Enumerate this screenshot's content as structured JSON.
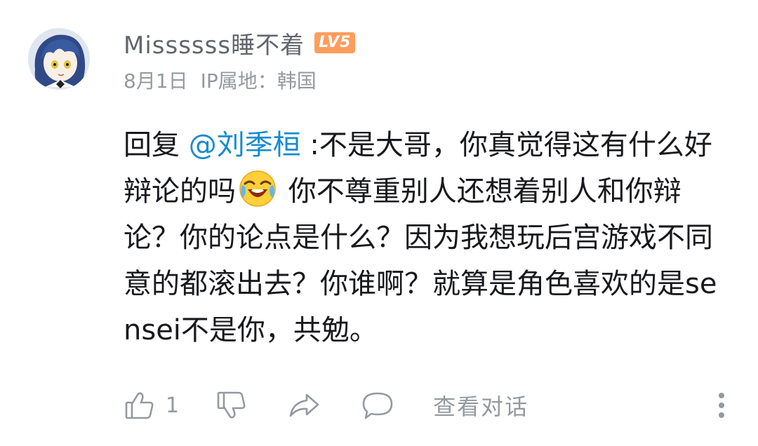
{
  "comment": {
    "username": "Missssss睡不着",
    "level": "LV5",
    "date": "8月1日",
    "ip_location": "IP属地：韩国",
    "content": {
      "reply_prefix": "回复 ",
      "mention": "@刘季桓",
      "part1": " :不是大哥，你真觉得这有什么好辩论的吗",
      "emoji": "laughing-crying-emoji",
      "part2": " 你不尊重别人还想着别人和你辩论？你的论点是什么？因为我想玩后宫游戏不同意的都滚出去？你谁啊？就算是角色喜欢的是sensei不是你，共勉。"
    },
    "like_count": "1",
    "view_conversation_label": "查看对话"
  },
  "colors": {
    "mention": "#178bcf",
    "level_badge": "#ff9d5c",
    "meta_text": "#9499a0",
    "username_text": "#61666d"
  },
  "icons": [
    "avatar",
    "thumbs-up-icon",
    "thumbs-down-icon",
    "share-icon",
    "comment-bubble-icon",
    "more-vertical-icon"
  ]
}
